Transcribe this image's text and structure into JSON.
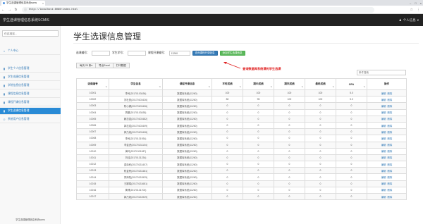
{
  "browser": {
    "tab_title": "学生选课管理信息系统scms",
    "url": "http://localhost:8080/index.html"
  },
  "app": {
    "brand": "学生选课管理信息系统SCMIS",
    "user_menu": "个人信息"
  },
  "sidebar": {
    "search_placeholder": "在此搜索...",
    "items": [
      {
        "icon": "home-icon",
        "glyph": "⌂",
        "label": "个人中心",
        "active": false
      },
      {
        "icon": "chart-icon",
        "glyph": "▮",
        "label": "学生个人信息管理",
        "active": false
      },
      {
        "icon": "chart-icon",
        "glyph": "▮",
        "label": "学生成绩信息管理",
        "active": false
      },
      {
        "icon": "chart-icon",
        "glyph": "▮",
        "label": "学院信息信息管理",
        "active": false
      },
      {
        "icon": "chart-icon",
        "glyph": "▮",
        "label": "课程信息信息管理",
        "active": false
      },
      {
        "icon": "chart-icon",
        "glyph": "▮",
        "label": "课程开课信息管理",
        "active": false
      },
      {
        "icon": "chart-icon",
        "glyph": "▮",
        "label": "学生选课信息管理",
        "active": true
      },
      {
        "icon": "user-icon",
        "glyph": "☺",
        "label": "系统用户信息管理",
        "active": false
      }
    ],
    "footer": "学生选课管理信息系统scms"
  },
  "main": {
    "title": "学生选课信息管理",
    "filters": {
      "label1": "选课编号：",
      "label2": "学生学号：",
      "label3": "课程开课编号：",
      "value3": "11260",
      "query_button": "查询课程开课信息",
      "add_button": "添加学生选课信息"
    },
    "annotation": "查询数据库系统课的学生选课",
    "toolbar": {
      "page_size": "每页 20 条",
      "export": "导出Excel",
      "print": "打印数据"
    },
    "table_search_placeholder": "条件搜索",
    "columns": [
      "选课编号",
      "学生信息",
      "课程开课信息",
      "平时成绩",
      "期中成绩",
      "期末成绩",
      "最终成绩",
      "GPA",
      "操作"
    ],
    "rows": [
      [
        "10001",
        "李司(20170103436)",
        "数据库系统(11260)",
        "100",
        "100",
        "100",
        "100",
        "5.0"
      ],
      [
        "10002",
        "刘杜勇(20170103426)",
        "数据库系统(11260)",
        "80",
        "95",
        "100",
        "100",
        "5.0"
      ],
      [
        "10003",
        "陈小娜(20170103406)",
        "数据库系统(11260)",
        "0",
        "0",
        "0",
        "0",
        "0"
      ],
      [
        "10004",
        "贾鹏(20170103435)",
        "数据库系统(11260)",
        "0",
        "0",
        "0",
        "0",
        "0"
      ],
      [
        "10005",
        "赖志强(20170103482)",
        "数据库系统(11260)",
        "0",
        "0",
        "0",
        "0",
        "0"
      ],
      [
        "10006",
        "郭志斌(20170103409)",
        "数据库系统(11260)",
        "0",
        "0",
        "0",
        "0",
        "0"
      ],
      [
        "10007",
        "郭乃炀(20170103408)",
        "数据库系统(11260)",
        "0",
        "0",
        "0",
        "0",
        "0"
      ],
      [
        "10008",
        "李司(20170131934)",
        "数据库系统(11260)",
        "0",
        "0",
        "0",
        "0",
        "0"
      ],
      [
        "10009",
        "李金虎(20170131104)",
        "数据库系统(11260)",
        "0",
        "0",
        "0",
        "0",
        "0"
      ],
      [
        "10010",
        "黄玛(20170131187)",
        "数据库系统(11260)",
        "0",
        "0",
        "0",
        "0",
        "0"
      ],
      [
        "10011",
        "刘佳(20170131234)",
        "数据库系统(11260)",
        "0",
        "0",
        "0",
        "0",
        "0"
      ],
      [
        "10012",
        "梁泽栋(20170131407)",
        "数据库系统(11260)",
        "0",
        "0",
        "0",
        "0",
        "0"
      ],
      [
        "10013",
        "陈金荣(20170131481)",
        "数据库系统(11260)",
        "0",
        "0",
        "0",
        "0",
        "0"
      ],
      [
        "10014",
        "郑泽阳(20170131529)",
        "数据库系统(11260)",
        "0",
        "0",
        "0",
        "0",
        "0"
      ],
      [
        "10015",
        "王娜娟(20170131681)",
        "数据库系统(11260)",
        "0",
        "0",
        "0",
        "0",
        "0"
      ],
      [
        "10016",
        "黄博(20170131703)",
        "数据库系统(11260)",
        "0",
        "0",
        "0",
        "0",
        "0"
      ],
      [
        "10017",
        "郭乃炀(20170131929)",
        "数据库系统(11260)",
        "0",
        "0",
        "0",
        "0",
        "0"
      ]
    ],
    "row_actions": {
      "edit": "编辑",
      "delete": "删除"
    }
  },
  "colors": {
    "header_bg": "#222222",
    "sidebar_active": "#2a8bd6",
    "primary": "#337ab7",
    "success": "#5cb85c",
    "annotation": "#e02020"
  }
}
